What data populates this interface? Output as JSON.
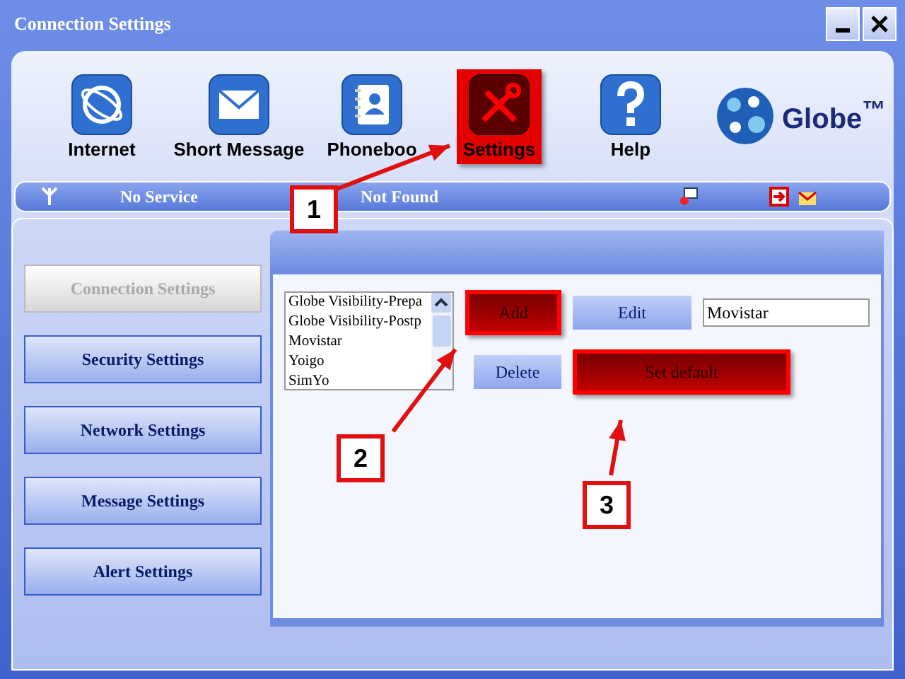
{
  "window": {
    "title": "Connection Settings"
  },
  "toolbar": [
    {
      "label": "Internet",
      "selected": false
    },
    {
      "label": "Short Message",
      "selected": false
    },
    {
      "label": "Phoneboo",
      "selected": false
    },
    {
      "label": "Settings",
      "selected": true
    },
    {
      "label": "Help",
      "selected": false
    }
  ],
  "logo": {
    "text": "Globe$^{™}$"
  },
  "status_bar": {
    "signal": "No Service",
    "network": "Not Found"
  },
  "sidebar": {
    "items": [
      {
        "label": "Connection Settings",
        "selected": true
      },
      {
        "label": "Security Settings",
        "selected": false
      },
      {
        "label": "Network Settings",
        "selected": false
      },
      {
        "label": "Message Settings",
        "selected": false
      },
      {
        "label": "Alert Settings",
        "selected": false
      }
    ]
  },
  "profiles": {
    "items": [
      "Globe Visibility-Prepa",
      "Globe Visibility-Postp",
      "Movistar",
      "Yoigo",
      "SimYo"
    ],
    "field_value": "Movistar"
  },
  "buttons": [
    {
      "label": "Add",
      "highlighted": true
    },
    {
      "label": "Edit",
      "highlighted": false
    },
    {
      "label": "Delete",
      "highlighted": false
    },
    {
      "label": "Set default",
      "highlighted": true
    }
  ],
  "callouts": [
    {
      "number": "1"
    },
    {
      "number": "2"
    },
    {
      "number": "3"
    }
  ]
}
